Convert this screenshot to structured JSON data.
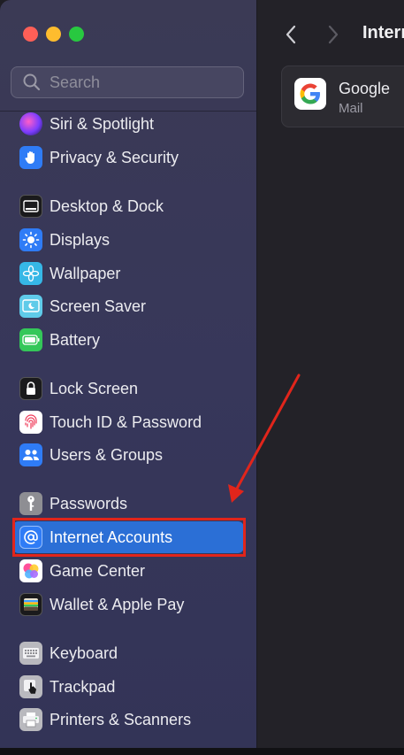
{
  "sidebar": {
    "search_placeholder": "Search",
    "items": [
      {
        "label": "Siri & Spotlight",
        "icon": "siri-icon"
      },
      {
        "label": "Privacy & Security",
        "icon": "hand-icon"
      },
      {
        "label": "Desktop & Dock",
        "icon": "dock-icon"
      },
      {
        "label": "Displays",
        "icon": "sun-icon"
      },
      {
        "label": "Wallpaper",
        "icon": "flower-icon"
      },
      {
        "label": "Screen Saver",
        "icon": "screensaver-icon"
      },
      {
        "label": "Battery",
        "icon": "battery-icon"
      },
      {
        "label": "Lock Screen",
        "icon": "lock-icon"
      },
      {
        "label": "Touch ID & Password",
        "icon": "fingerprint-icon"
      },
      {
        "label": "Users & Groups",
        "icon": "users-icon"
      },
      {
        "label": "Passwords",
        "icon": "key-icon"
      },
      {
        "label": "Internet Accounts",
        "icon": "at-icon",
        "selected": true
      },
      {
        "label": "Game Center",
        "icon": "game-center-icon"
      },
      {
        "label": "Wallet & Apple Pay",
        "icon": "wallet-icon"
      },
      {
        "label": "Keyboard",
        "icon": "keyboard-icon"
      },
      {
        "label": "Trackpad",
        "icon": "trackpad-icon"
      },
      {
        "label": "Printers & Scanners",
        "icon": "printer-icon"
      }
    ]
  },
  "main": {
    "title": "Intern",
    "accounts": [
      {
        "name": "Google",
        "detail": "Mail",
        "icon": "google-icon"
      }
    ]
  },
  "colors": {
    "selection": "#2b6fd6",
    "annotation": "#e1251b"
  }
}
